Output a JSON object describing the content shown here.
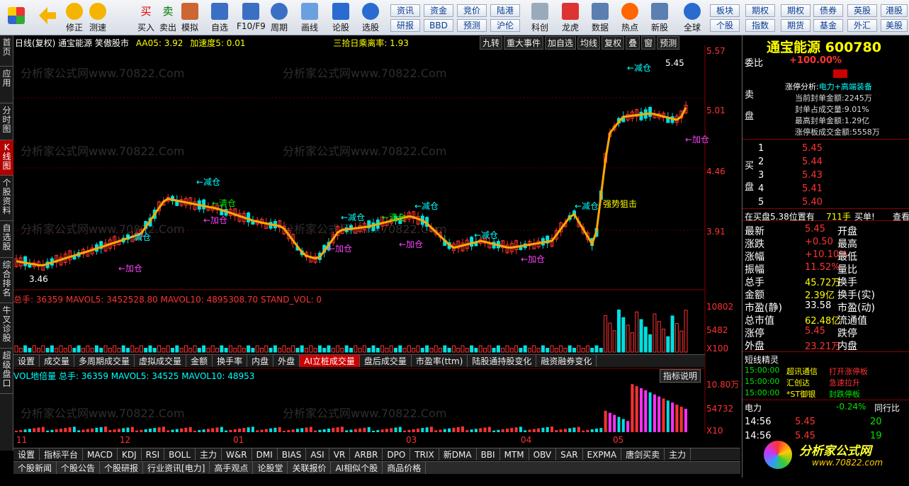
{
  "toolbar": {
    "buttons": [
      {
        "label": "修正"
      },
      {
        "label": "测速"
      },
      {
        "label": "买入"
      },
      {
        "label": "卖出"
      },
      {
        "label": "模拟"
      },
      {
        "label": "自选"
      },
      {
        "label": "F10/F9"
      },
      {
        "label": "周期"
      },
      {
        "label": "画线"
      },
      {
        "label": "论股"
      },
      {
        "label": "选股"
      },
      {
        "label": "科创"
      },
      {
        "label": "龙虎"
      },
      {
        "label": "数据"
      },
      {
        "label": "热点"
      },
      {
        "label": "新股"
      },
      {
        "label": "全球"
      }
    ],
    "quick": [
      "资讯",
      "资金",
      "竞价",
      "陆港",
      "研报",
      "BBD",
      "预测",
      "沪伦",
      "板块",
      "期权",
      "期权",
      "债券",
      "英股",
      "港股",
      "个股",
      "指数",
      "期货",
      "基金",
      "外汇",
      "美股"
    ]
  },
  "vtabs": [
    "首页",
    "应用",
    "分时图",
    "K线图",
    "个股资料",
    "自选股",
    "综合排名",
    "牛叉诊股",
    "超级盘口"
  ],
  "chart": {
    "title": "日线(复权) 通宝能源 笑傲股市",
    "aa05": "AA05: 3.92",
    "accel": "加速度5: 0.01",
    "ratio": "三拾日乘离率: 1.93",
    "buttons": [
      "九转",
      "重大事件",
      "加自选",
      "均线",
      "复权",
      "叠",
      "窗",
      "预测"
    ],
    "price_ticks": [
      "5.57",
      "5.01",
      "4.46",
      "3.91"
    ],
    "low_label": "3.46",
    "high_label": "5.45",
    "vol_header": "总手: 36359 MAVOL5: 3452528.80 MAVOL10: 4895308.70 STAND_VOL: 0",
    "vol_ticks": [
      "10802",
      "5482",
      "X100"
    ],
    "vol2_header": "VOL地倍量 总手: 36359 MAVOL5: 34525 MAVOL10: 48953",
    "vol2_ticks": [
      "10.80万",
      "54732",
      "X10"
    ],
    "explain": "指标说明",
    "ind_tabs": [
      "设置",
      "成交量",
      "多周期成交量",
      "虚拟成交量",
      "金额",
      "换手率",
      "内盘",
      "外盘",
      "AI立桩成交量",
      "盘后成交量",
      "市盈率(ttm)",
      "陆股通持股变化",
      "融资融券变化"
    ],
    "months": [
      "11",
      "12",
      "01",
      "03",
      "04",
      "05"
    ],
    "bottom_tabs": [
      "设置",
      "指标平台",
      "MACD",
      "KDJ",
      "RSI",
      "BOLL",
      "主力",
      "W&R",
      "DMI",
      "BIAS",
      "ASI",
      "VR",
      "ARBR",
      "DPO",
      "TRIX",
      "新DMA",
      "BBI",
      "MTM",
      "OBV",
      "SAR",
      "EXPMA",
      "唐剑买卖",
      "主力"
    ],
    "news_tabs": [
      "个股新闻",
      "个股公告",
      "个股研报",
      "行业资讯[电力]",
      "高手观点",
      "论股堂",
      "关联报价",
      "AI相似个股",
      "商品价格"
    ],
    "annotations": {
      "reduce": "←减仓",
      "add": "←加仓",
      "clear": "←清仓",
      "strong": "强势狙击"
    },
    "watermark": "分析家公式网www.70822.Com"
  },
  "right": {
    "name": "通宝能源",
    "code": "600780",
    "weibi_label": "委比",
    "weibi": "+100.00%",
    "limit_title": "涨停分析:",
    "limit_sector": "电力+高端装备",
    "limit_lines": [
      {
        "k": "当前封单金额:",
        "v": "2245万"
      },
      {
        "k": "封单占成交量:",
        "v": "9.01%"
      },
      {
        "k": "最高封单金额:",
        "v": "1.29亿"
      },
      {
        "k": "涨停板成交金额:",
        "v": "5558万"
      }
    ],
    "sell_label": "卖盘",
    "buy_label": "买盘",
    "buys": [
      {
        "n": "1",
        "p": "5.45"
      },
      {
        "n": "2",
        "p": "5.44"
      },
      {
        "n": "3",
        "p": "5.43"
      },
      {
        "n": "4",
        "p": "5.41"
      },
      {
        "n": "5",
        "p": "5.40"
      }
    ],
    "buy_note": "在买盘5.38位置有",
    "buy_vol": "711手",
    "buy_act": "买单!",
    "buy_view": "查看",
    "stats": [
      {
        "k": "最新",
        "v": "5.45",
        "k2": "开盘"
      },
      {
        "k": "涨跌",
        "v": "+0.50",
        "k2": "最高"
      },
      {
        "k": "涨幅",
        "v": "+10.10%",
        "k2": "最低"
      },
      {
        "k": "振幅",
        "v": "11.52%",
        "k2": "量比"
      },
      {
        "k": "总手",
        "v": "45.72万",
        "k2": "换手"
      },
      {
        "k": "金额",
        "v": "2.39亿",
        "k2": "换手(实)"
      },
      {
        "k": "市盈(静)",
        "v": "33.58",
        "k2": "市盈(动)"
      },
      {
        "k": "总市值",
        "v": "62.48亿",
        "k2": "流通值"
      },
      {
        "k": "涨停",
        "v": "5.45",
        "k2": "跌停"
      },
      {
        "k": "外盘",
        "v": "23.21万",
        "k2": "内盘"
      }
    ],
    "elite_title": "短线精灵",
    "elite": [
      {
        "t": "15:00:00",
        "n": "超讯通信",
        "e": "打开涨停板"
      },
      {
        "t": "15:00:00",
        "n": "汇创达",
        "e": "急速拉升"
      },
      {
        "t": "15:00:00",
        "n": "*ST御银",
        "e": "封跌停板"
      }
    ],
    "sector": "电力",
    "sector_chg": "-0.24%",
    "sector_more": "同行比",
    "ticks": [
      {
        "t": "14:56",
        "p": "5.45",
        "v": "20"
      },
      {
        "t": "14:56",
        "p": "5.45",
        "v": "19"
      }
    ],
    "logo": "分析家公式网",
    "logo_url": "www.70822.com"
  }
}
